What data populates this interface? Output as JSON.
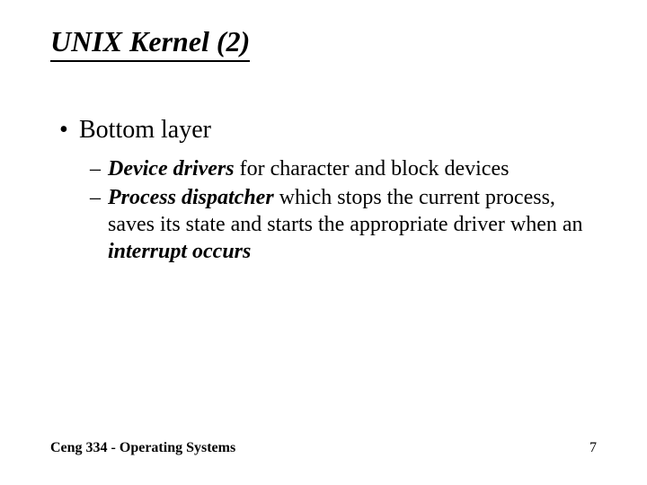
{
  "title": "UNIX Kernel (2)",
  "bullet": {
    "dot": "•",
    "text": "Bottom layer"
  },
  "sub": {
    "dash": "–",
    "item1": {
      "em": "Device drivers",
      "rest": " for character and block devices"
    },
    "item2": {
      "em": "Process dispatcher",
      "mid": " which stops the current process, saves its state and starts the appropriate driver when an ",
      "em2": "interrupt occurs"
    }
  },
  "footer": {
    "left": "Ceng 334 - Operating Systems",
    "right": "7"
  }
}
